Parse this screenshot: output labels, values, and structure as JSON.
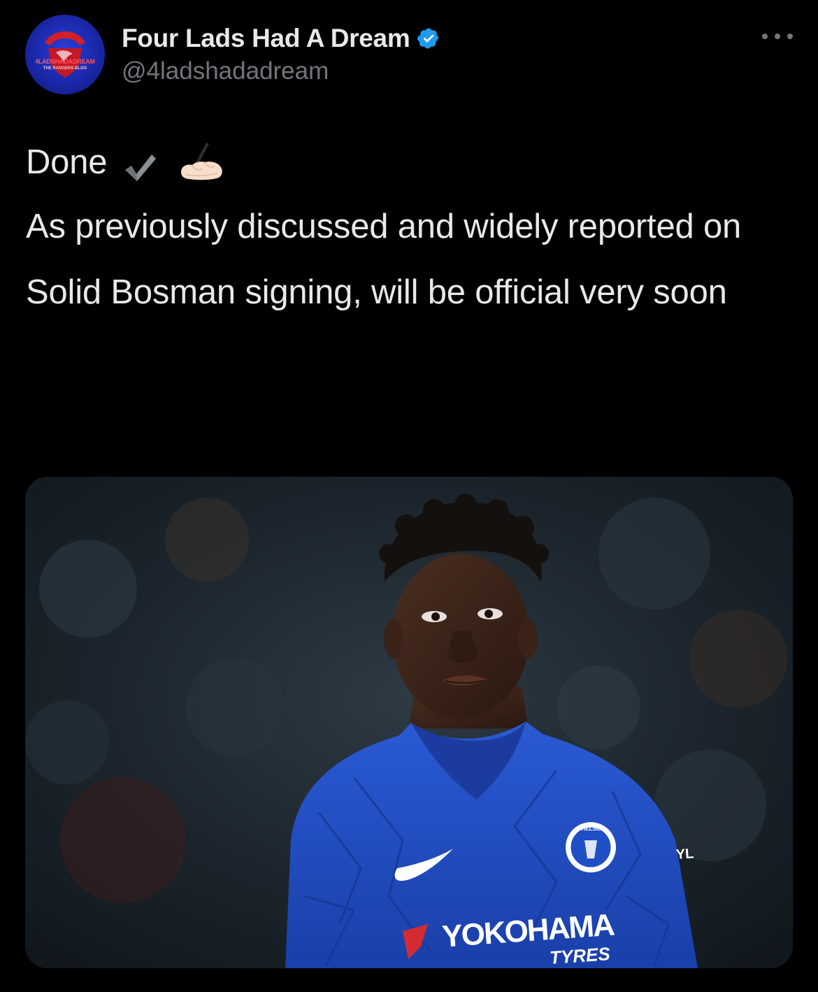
{
  "tweet": {
    "author": {
      "display_name": "Four Lads Had A Dream",
      "handle": "@4ladshadadream",
      "verified": true,
      "avatar": {
        "logo_text_top": "4LADSHADADREAM",
        "logo_text_bottom": "THE RANGERS BLOG"
      }
    },
    "more_icon": "more-horizontal-icon",
    "text": {
      "line1": "Done",
      "line1_emoji": [
        "heavy-check-mark-icon",
        "writing-hand-icon"
      ],
      "paragraph2": "As previously discussed and widely reported on",
      "paragraph3": "Solid Bosman signing, will be official very soon"
    },
    "media": {
      "kit_sponsor": "YOKOHAMA",
      "kit_sponsor_sub": "TYRES",
      "badge_text": "CHELSEA",
      "sleeve_text": "YL"
    }
  },
  "colors": {
    "background": "#000000",
    "text_primary": "#e7e9ea",
    "text_secondary": "#71767b",
    "verified_blue": "#1d9bf0",
    "kit_blue": "#1f4fc4"
  }
}
